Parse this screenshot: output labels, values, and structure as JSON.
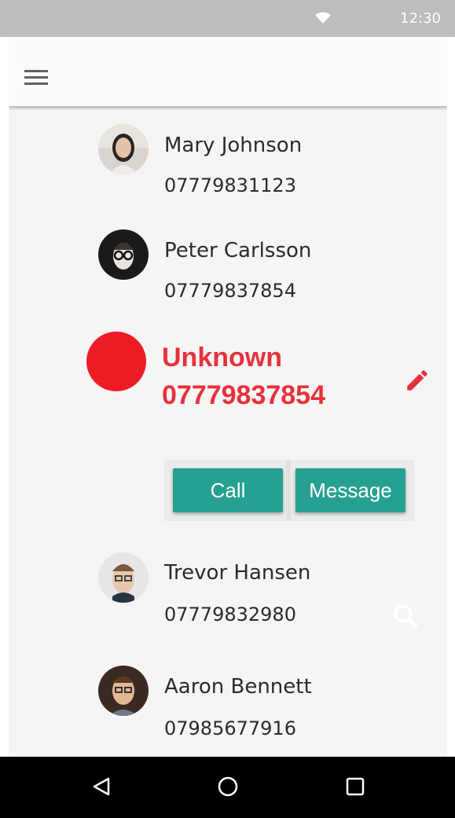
{
  "status_bar": {
    "time": "12:30"
  },
  "app_bar": {
    "menu_icon": "menu-icon"
  },
  "contacts": [
    {
      "name": "Mary Johnson",
      "phone": "07779831123"
    },
    {
      "name": "Peter Carlsson",
      "phone": "07779837854"
    },
    {
      "name": "Trevor Hansen",
      "phone": "07779832980"
    },
    {
      "name": "Aaron Bennett",
      "phone": "07985677916"
    }
  ],
  "selected_contact": {
    "name": "Unknown",
    "phone": "07779837854"
  },
  "actions": {
    "call_label": "Call",
    "message_label": "Message"
  },
  "colors": {
    "accent_red": "#ed1c24",
    "teal": "#26a091",
    "status_bar": "#bdbdbd"
  },
  "navigation": {
    "back_icon": "back-triangle-icon",
    "home_icon": "home-circle-icon",
    "recents_icon": "recents-square-icon"
  }
}
